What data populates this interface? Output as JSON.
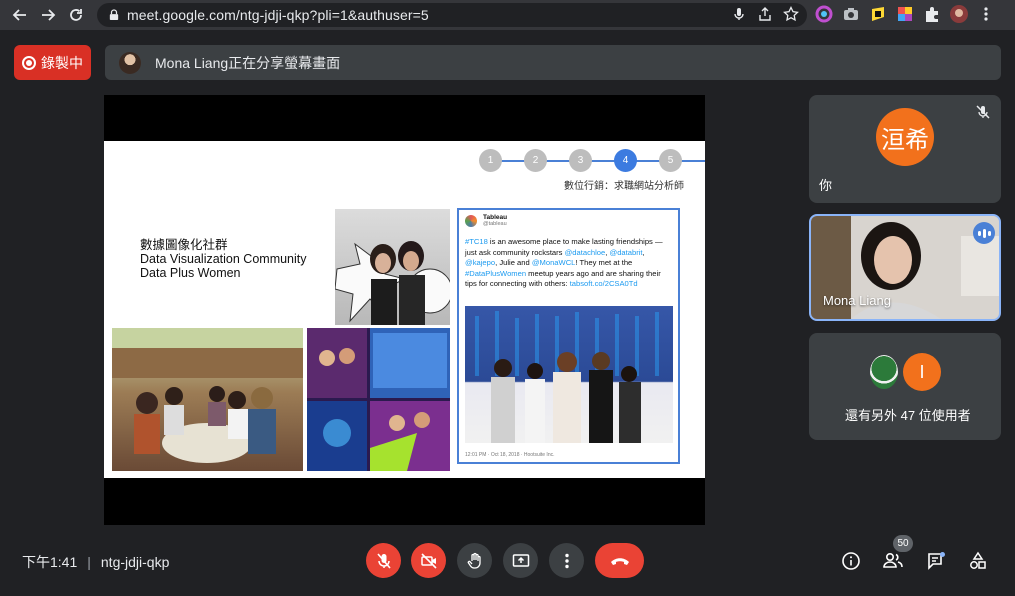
{
  "browser": {
    "url": "meet.google.com/ntg-jdji-qkp?pli=1&authuser=5"
  },
  "meet": {
    "recording_label": "錄製中",
    "share_banner": "Mona Liang正在分享螢幕畫面",
    "meeting_time": "下午1:41",
    "meeting_code": "ntg-jdji-qkp",
    "people_count": "50"
  },
  "slide": {
    "steps": [
      "1",
      "2",
      "3",
      "4",
      "5"
    ],
    "active_step": "4",
    "subtitle": "數位行銷：求職網站分析師",
    "title_zh": "數據圖像化社群",
    "title_en1": "Data Visualization Community",
    "title_en2": "Data Plus Women",
    "tweet": {
      "name": "Tableau",
      "handle": "@tableau",
      "p1": "#TC18",
      "p2": " is an awesome place to make lasting friendships —just ask community rockstars ",
      "p3": "@datachloe",
      "p4": ", ",
      "p5": "@databrit",
      "p6": ", ",
      "p7": "@kajepo",
      "p8": ", Julie and ",
      "p9": "@MonaWCL",
      "p10": "! They met at the ",
      "p11": "#DataPlusWomen",
      "p12": " meetup years ago and are sharing their tips for connecting with others: ",
      "p13": "tabsoft.co/2CSA0Td",
      "footer": "12:01 PM · Oct 18, 2018 · Hootsuite Inc."
    }
  },
  "tiles": {
    "you_avatar": "洹希",
    "you_label": "你",
    "mona_label": "Mona Liang",
    "more_initial": "I",
    "more_label": "還有另外 47 位使用者"
  }
}
